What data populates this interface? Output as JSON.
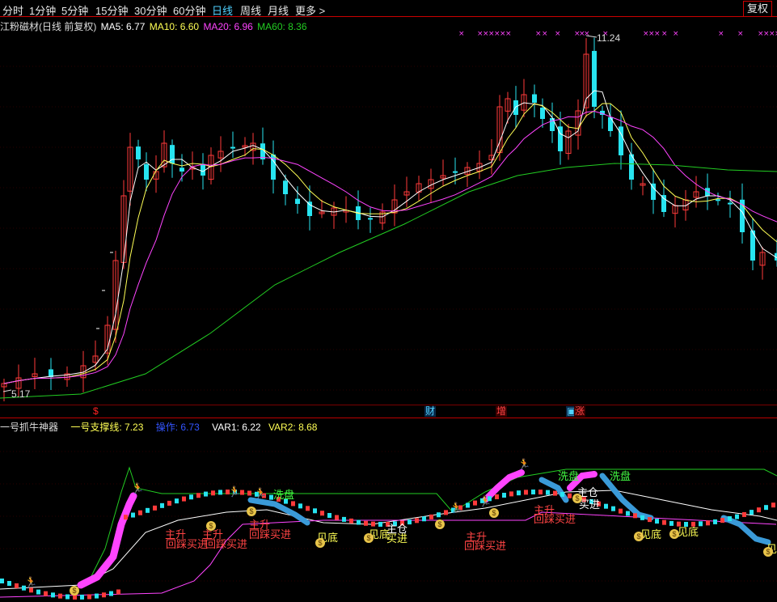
{
  "toolbar": {
    "items": [
      "分时",
      "1分钟",
      "5分钟",
      "15分钟",
      "30分钟",
      "60分钟",
      "日线",
      "周线",
      "月线",
      "更多 >"
    ],
    "active_index": 6,
    "fuquan_label": "复权"
  },
  "main_legend": {
    "title": "江粉磁材(日线 前复权)",
    "ma5": "MA5: 6.77",
    "ma10": "MA10: 6.60",
    "ma20": "MA20: 6.96",
    "ma60": "MA60: 8.36",
    "colors": {
      "title": "#dddddd",
      "ma5": "#ffffff",
      "ma10": "#ffff55",
      "ma20": "#ff44ff",
      "ma60": "#22cc22"
    }
  },
  "price_labels": {
    "high": "11.24",
    "low": "5.17"
  },
  "events": [
    {
      "text": "财",
      "color": "#4fd1ff",
      "bg": "#0a2a4a"
    },
    {
      "text": "增",
      "color": "#ff4444",
      "bg": "#3a0000"
    },
    {
      "text": "涨",
      "color": "#ff4444",
      "bg": "#3a0000"
    },
    {
      "text": "$",
      "color": "#ff2222",
      "bg": "transparent"
    }
  ],
  "indicator_legend": {
    "name": "一号抓牛神器",
    "support": "一号支撑线: 7.23",
    "op": "操作: 6.73",
    "var1": "VAR1: 6.22",
    "var2": "VAR2: 8.68",
    "colors": {
      "name": "#dddddd",
      "support": "#ffff55",
      "op": "#3355ff",
      "var1": "#ffffff",
      "var2": "#ffff55"
    }
  },
  "signals": {
    "zhusheng": "主升",
    "huicai": "回踩买进",
    "xipan": "洗盘",
    "jiandi": "见底",
    "zhucang": "主仓",
    "mairu": "买进",
    "money": "$"
  },
  "chart_data": {
    "type": "candlestick",
    "symbol": "江粉磁材",
    "period": "日线",
    "adjust": "前复权",
    "ma": {
      "MA5": 6.77,
      "MA10": 6.6,
      "MA20": 6.96,
      "MA60": 8.36
    },
    "marked_high": 11.24,
    "marked_low": 5.17,
    "indicator": {
      "name": "一号抓牛神器",
      "一号支撑线": 7.23,
      "操作": 6.73,
      "VAR1": 6.22,
      "VAR2": 8.68
    }
  }
}
